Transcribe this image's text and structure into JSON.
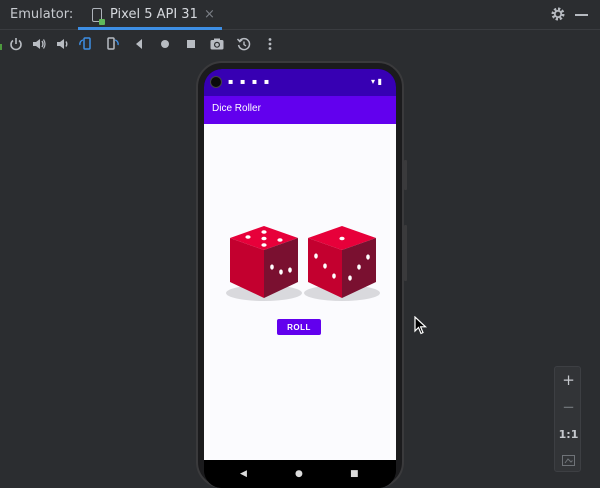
{
  "toolwindow": {
    "title": "Emulator:",
    "tab": {
      "label": "Pixel 5 API 31",
      "close": "×"
    }
  },
  "toolbar": {
    "buttons": [
      "power-icon",
      "volume-up-icon",
      "volume-down-icon",
      "rotate-left-icon",
      "rotate-right-icon",
      "back-icon",
      "home-icon",
      "overview-icon",
      "screenshot-icon",
      "snapshot-icon",
      "more-icon"
    ]
  },
  "device": {
    "app_title": "Dice Roller",
    "roll_label": "ROLL",
    "status_left": "▪ ▪ ▪ ▪",
    "status_right": "▾ ▮",
    "dice": [
      {
        "name": "die-left",
        "top_face_pips": 5,
        "right_face_pips": 3,
        "left_face_pips": 0
      },
      {
        "name": "die-right",
        "top_face_pips": 1,
        "right_face_pips": 3,
        "left_face_pips": 3
      }
    ],
    "nav": {
      "back": "◀",
      "home": "●",
      "recents": "■"
    },
    "colors": {
      "statusbar": "#3700b3",
      "appbar": "#6200ee",
      "die_red": "#c3002f"
    }
  },
  "zoom": {
    "zoom_in": "+",
    "zoom_out": "−",
    "actual_size": "1:1"
  }
}
